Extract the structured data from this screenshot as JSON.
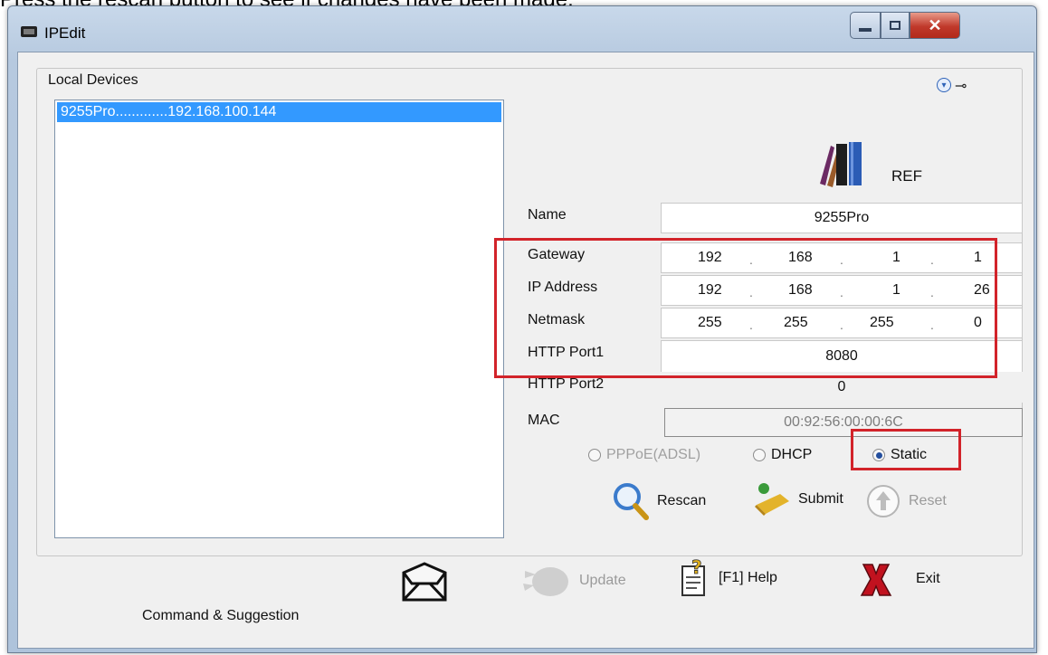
{
  "caption": "Press the rescan button to see if changes have been made.",
  "window": {
    "title": "IPEdit"
  },
  "group_label": "Local Devices",
  "devices": [
    "9255Pro.............192.168.100.144"
  ],
  "ref": {
    "label": "REF"
  },
  "fields": {
    "name": {
      "label": "Name",
      "value": "9255Pro"
    },
    "gateway": {
      "label": "Gateway",
      "octets": [
        "192",
        "168",
        "1",
        "1"
      ]
    },
    "ip": {
      "label": "IP Address",
      "octets": [
        "192",
        "168",
        "1",
        "26"
      ]
    },
    "netmask": {
      "label": "Netmask",
      "octets": [
        "255",
        "255",
        "255",
        "0"
      ]
    },
    "port1": {
      "label": "HTTP Port1",
      "value": "8080"
    },
    "port2": {
      "label": "HTTP Port2",
      "value": "0"
    },
    "mac": {
      "label": "MAC",
      "value": "00:92:56:00:00:6C"
    }
  },
  "radios": {
    "pppoe": "PPPoE(ADSL)",
    "dhcp": "DHCP",
    "static": "Static",
    "selected": "static"
  },
  "actions": {
    "rescan": "Rescan",
    "submit": "Submit",
    "reset": "Reset"
  },
  "bottom": {
    "update": "Update",
    "help": "[F1] Help",
    "exit": "Exit",
    "command": "Command & Suggestion"
  },
  "colors": {
    "highlight": "#d2232a",
    "selection": "#3399ff"
  }
}
